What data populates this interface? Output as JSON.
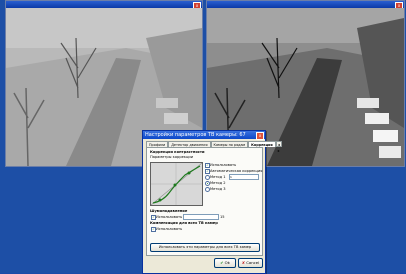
{
  "left_camera": {
    "title": "",
    "close": "x"
  },
  "right_camera": {
    "title": "",
    "close": "x"
  },
  "dialog": {
    "title": "Настройки параметров ТВ камеры: 67",
    "close": "x",
    "tabs": [
      "Профили",
      "Детектор движения",
      "Камеры по рядам",
      "Коррекция"
    ],
    "tab_arrows": "◂ ▸",
    "section_correction": "Коррекция контрастности",
    "correction_params": "Параметры коррекции",
    "use_label": "Использовать",
    "auto_correction": "Автоматическая коррекция",
    "method1": "Метод 1",
    "method2": "Метод 2",
    "method3": "Метод 3",
    "method1_value": "1",
    "noise_section": "Шумоподавление",
    "noise_use": "Использовать",
    "noise_value": "15",
    "compensation_section": "Компенсация для всех ТВ камер",
    "compensation_use": "Использовать",
    "apply_all_button": "Использовать эти параметры для всех ТВ камер",
    "ok_icon": "✔",
    "ok_button": "Ok",
    "cancel_icon": "✘",
    "cancel_button": "Cancel"
  }
}
